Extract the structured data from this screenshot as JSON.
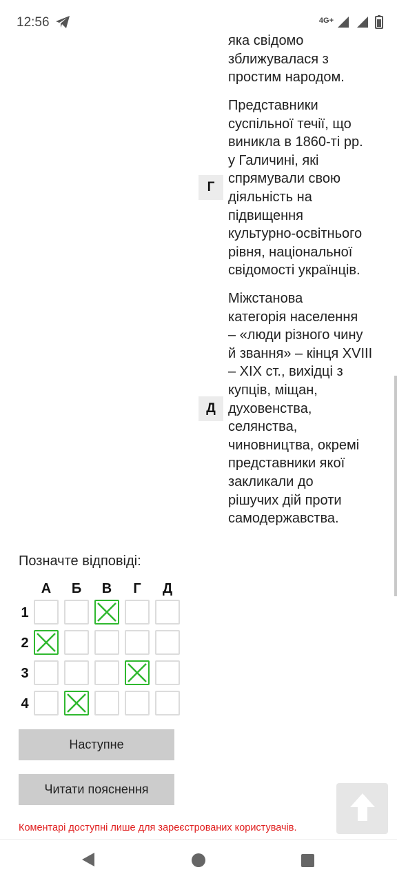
{
  "status_bar": {
    "time": "12:56",
    "network": "4G+"
  },
  "options": [
    {
      "letter": "",
      "text": "яка свідомо\nзближувалася з\nпростим народом."
    },
    {
      "letter": "Г",
      "text": "Представники\nсуспільної течії, що\nвиникла в 1860-ті рр.\nу Галичині, які\nспрямували свою\nдіяльність на\nпідвищення\nкультурно-освітнього\nрівня, національної\nсвідомості українців."
    },
    {
      "letter": "Д",
      "text": "Міжстанова\nкатегорія населення\n– «люди різного чину\nй звання» – кінця XVIII\n– XIX ст., вихідці з\nкупців, міщан,\nдуховенства,\nселянства,\nчиновництва, окремі\nпредставники якої\nзакликали до\nрішучих дій проти\nсамодержавства."
    }
  ],
  "answer_grid": {
    "prompt": "Позначте відповіді:",
    "columns": [
      "А",
      "Б",
      "В",
      "Г",
      "Д"
    ],
    "rows": [
      "1",
      "2",
      "3",
      "4"
    ],
    "selected": {
      "1": "В",
      "2": "А",
      "3": "Г",
      "4": "Б"
    },
    "check_color": "#2fb82f"
  },
  "buttons": {
    "next_label": "Наступне",
    "explain_label": "Читати пояснення"
  },
  "comments_note": "Коментарі доступні лише для зареєстрованих користувачів.",
  "colors": {
    "accent_green": "#2fb82f",
    "warning_red": "#e02020",
    "button_gray": "#cccccc"
  },
  "icons": [
    "telegram-icon",
    "signal-icon",
    "battery-icon",
    "arrow-up-icon",
    "back-icon",
    "home-icon",
    "recent-apps-icon"
  ]
}
